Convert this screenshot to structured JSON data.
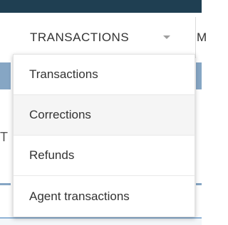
{
  "nav": {
    "active_tab": "TRANSACTIONS",
    "next_tab_partial": "M"
  },
  "background": {
    "left_fragment": "T"
  },
  "dropdown": {
    "items": [
      {
        "label": "Transactions",
        "highlighted": false
      },
      {
        "label": "Corrections",
        "highlighted": true
      },
      {
        "label": "Refunds",
        "highlighted": false
      },
      {
        "label": "Agent transactions",
        "highlighted": false
      }
    ]
  },
  "colors": {
    "topbar": "#1f3f52",
    "accent_blue": "#86a6c4",
    "text": "#333333"
  }
}
